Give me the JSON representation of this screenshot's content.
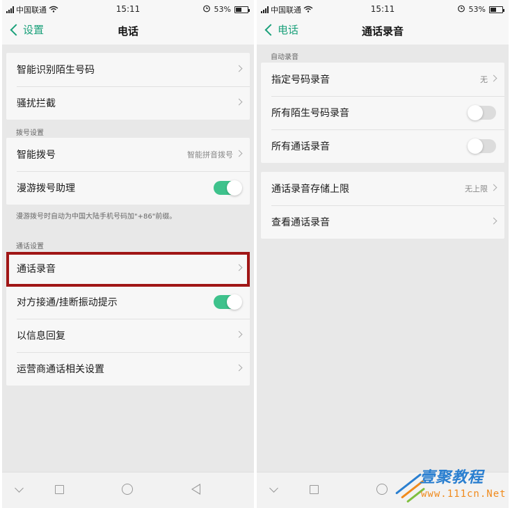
{
  "status_bar": {
    "carrier": "中国联通",
    "time": "15:11",
    "battery": "53%",
    "battery_level": 0.53
  },
  "left_screen": {
    "back_label": "设置",
    "title": "电话",
    "group1": [
      {
        "label": "智能识别陌生号码"
      },
      {
        "label": "骚扰拦截"
      }
    ],
    "section_dial": "拨号设置",
    "group2": [
      {
        "label": "智能拨号",
        "value": "智能拼音拨号"
      },
      {
        "label": "漫游拨号助理",
        "toggle": "on"
      }
    ],
    "roaming_note": "漫游拨号时自动为中国大陆手机号码加\"+86\"前缀。",
    "section_call": "通话设置",
    "group3": [
      {
        "label": "通话录音"
      },
      {
        "label": "对方接通/挂断振动提示",
        "toggle": "on"
      },
      {
        "label": "以信息回复"
      },
      {
        "label": "运营商通话相关设置"
      }
    ]
  },
  "right_screen": {
    "back_label": "电话",
    "title": "通话录音",
    "section_auto": "自动录音",
    "group1": [
      {
        "label": "指定号码录音",
        "value": "无"
      },
      {
        "label": "所有陌生号码录音",
        "toggle": "off"
      },
      {
        "label": "所有通话录音",
        "toggle": "off"
      }
    ],
    "group2": [
      {
        "label": "通话录音存储上限",
        "value": "无上限"
      },
      {
        "label": "查看通话录音"
      }
    ]
  },
  "watermark": {
    "name": "壹聚教程",
    "url": "www.111cn.Net"
  },
  "colors": {
    "accent": "#1aa07a",
    "toggle_on": "#3ec28c",
    "highlight": "#a01616"
  }
}
